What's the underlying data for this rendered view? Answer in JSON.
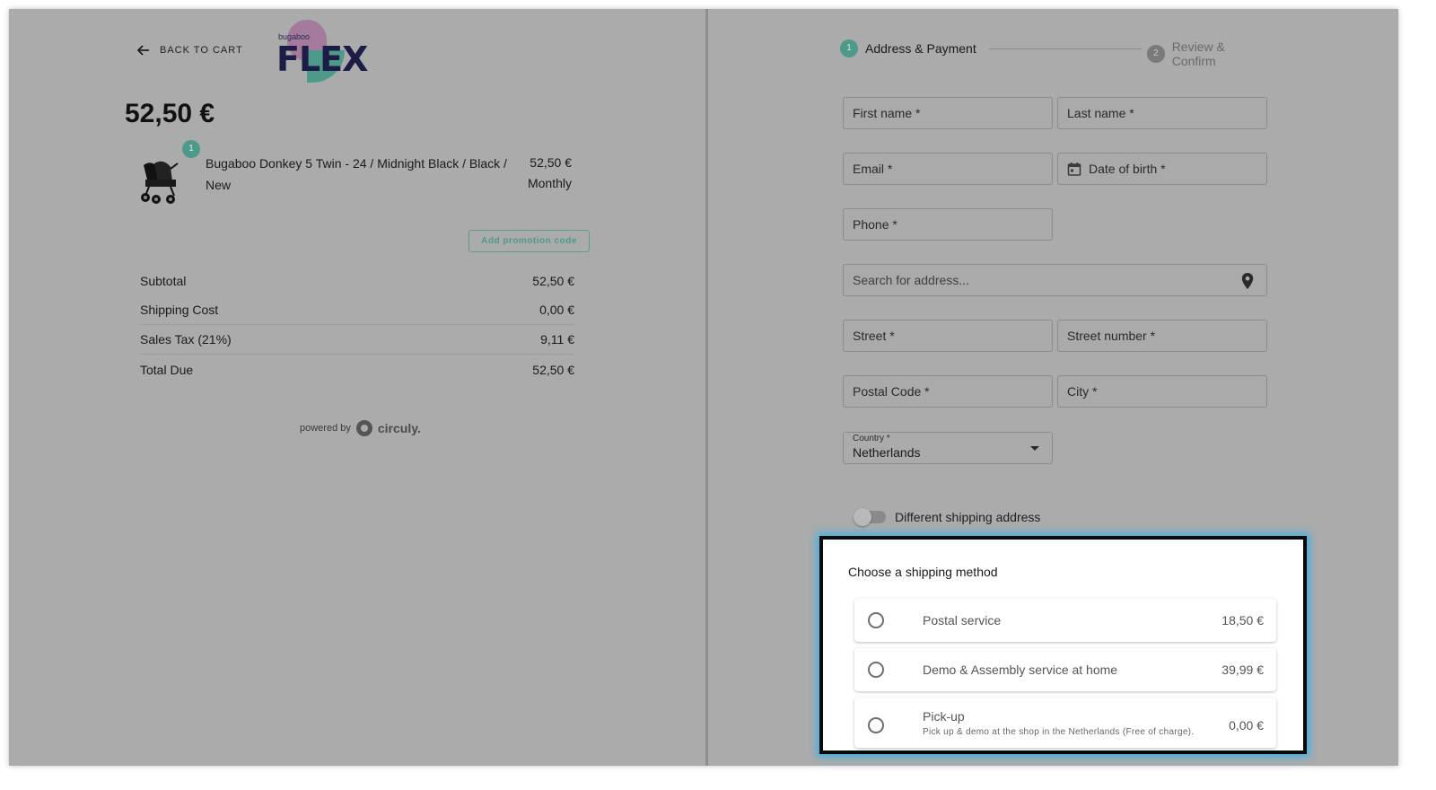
{
  "left": {
    "back_label": "BACK TO CART",
    "logo": {
      "small": "bugaboo",
      "big": "FLEX"
    },
    "total_price": "52,50 €",
    "product": {
      "quantity": "1",
      "name": "Bugaboo Donkey 5 Twin - 24 / Midnight Black / Black / New",
      "price": "52,50 €",
      "period": "Monthly"
    },
    "promo_label": "Add promotion code",
    "summary": [
      {
        "label": "Subtotal",
        "value": "52,50 €"
      },
      {
        "label": "Shipping Cost",
        "value": "0,00 €"
      },
      {
        "label": "Sales Tax (21%)",
        "value": "9,11 €"
      },
      {
        "label": "Total Due",
        "value": "52,50 €"
      }
    ],
    "powered_by": "powered by",
    "powered_brand": "circuly."
  },
  "stepper": {
    "steps": [
      {
        "num": "1",
        "label": "Address & Payment"
      },
      {
        "num": "2",
        "label": "Review & Confirm"
      }
    ]
  },
  "form": {
    "first_name": "First name *",
    "last_name": "Last name *",
    "email": "Email *",
    "dob": "Date of birth *",
    "phone": "Phone *",
    "search": "Search for address...",
    "street": "Street *",
    "street_number": "Street number *",
    "postal_code": "Postal Code *",
    "city": "City *",
    "country_label": "Country *",
    "country_value": "Netherlands",
    "toggle_label": "Different shipping address"
  },
  "shipping": {
    "title": "Choose a shipping method",
    "options": [
      {
        "name": "Postal service",
        "price": "18,50 €"
      },
      {
        "name": "Demo & Assembly service at home",
        "price": "39,99 €"
      },
      {
        "name": "Pick-up",
        "sub": "Pick up & demo at the shop in the Netherlands (Free of charge).",
        "price": "0,00 €"
      }
    ]
  },
  "colors": {
    "accent": "#4e9a8a",
    "highlight": "#3db0e8"
  }
}
